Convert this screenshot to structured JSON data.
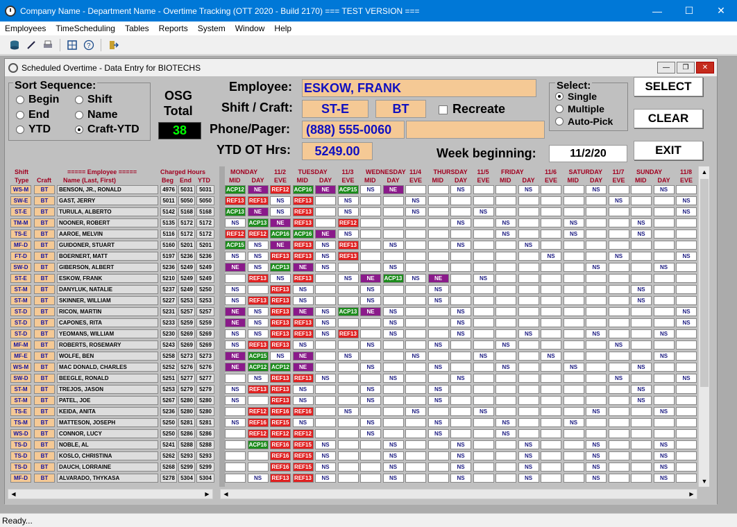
{
  "window": {
    "title": "Company Name - Department Name - Overtime Tracking (OTT 2020 - Build 2170)  === TEST VERSION ==="
  },
  "menu": [
    "Employees",
    "TimeScheduling",
    "Tables",
    "Reports",
    "System",
    "Window",
    "Help"
  ],
  "child": {
    "title": "Scheduled Overtime - Data Entry for BIOTECHS"
  },
  "sort": {
    "legend": "Sort Sequence:",
    "options": [
      {
        "label": "Begin",
        "selected": false
      },
      {
        "label": "End",
        "selected": false
      },
      {
        "label": "YTD",
        "selected": false
      },
      {
        "label": "Shift",
        "selected": false
      },
      {
        "label": "Name",
        "selected": false
      },
      {
        "label": "Craft-YTD",
        "selected": true
      }
    ]
  },
  "osg": {
    "label1": "OSG",
    "label2": "Total",
    "value": "38"
  },
  "employee": {
    "label": "Employee:",
    "value": "ESKOW, FRANK",
    "shift_label": "Shift / Craft:",
    "shift": "ST-E",
    "craft": "BT",
    "recreate_label": "Recreate",
    "phone_label": "Phone/Pager:",
    "phone": "(888) 555-0060",
    "ytd_label": "YTD OT Hrs:",
    "ytd": "5249.00",
    "week_label": "Week beginning:",
    "week": "11/2/20"
  },
  "select": {
    "legend": "Select:",
    "options": [
      {
        "label": "Single",
        "selected": true
      },
      {
        "label": "Multiple",
        "selected": false
      },
      {
        "label": "Auto-Pick",
        "selected": false
      }
    ]
  },
  "buttons": {
    "select": "SELECT",
    "clear": "CLEAR",
    "exit": "EXIT"
  },
  "grid": {
    "left_headers": {
      "shift": "Shift",
      "type": "Type",
      "craft": "Craft",
      "employee": "===== Employee =====",
      "name": "Name (Last, First)",
      "charged": "Charged Hours",
      "beg": "Beg",
      "end": "End",
      "ytd": "YTD"
    },
    "days": [
      {
        "name": "MONDAY",
        "date": "11/2"
      },
      {
        "name": "TUESDAY",
        "date": "11/3"
      },
      {
        "name": "WEDNESDAY",
        "date": "11/4"
      },
      {
        "name": "THURSDAY",
        "date": "11/5"
      },
      {
        "name": "FRIDAY",
        "date": "11/6"
      },
      {
        "name": "SATURDAY",
        "date": "11/7"
      },
      {
        "name": "SUNDAY",
        "date": "11/8"
      }
    ],
    "shift_cols": [
      "MID",
      "DAY",
      "EVE"
    ],
    "rows": [
      [
        "WS-M",
        "BT",
        "BENSON, JR., RONALD",
        "4976",
        "5031",
        "5031",
        "ACP12|NE|REF12|ACP16|NE|ACP15|NS|NE|||NS|||NS|||NS|||NS"
      ],
      [
        "SW-E",
        "BT",
        "GAST, JERRY",
        "5011",
        "5050",
        "5050",
        "REF13|REF13|NS|REF13||NS|||NS|||||||||NS|||NS"
      ],
      [
        "ST-E",
        "BT",
        "TURULA, ALBERTO",
        "5142",
        "5168",
        "5168",
        "ACP13|NE|NS|REF13||NS|||NS|||NS|||||||||NS"
      ],
      [
        "TM-M",
        "BT",
        "NOONER, ROBERT",
        "5135",
        "5172",
        "5172",
        "NS|ACP13|NE|REF13||REF12|||||NS||NS|||NS|||NS"
      ],
      [
        "TS-E",
        "BT",
        "AAROE, MELVIN",
        "5116",
        "5172",
        "5172",
        "REF12|REF12|ACP16|ACP16|NE|NS|||||||NS|||NS|||NS"
      ],
      [
        "MF-D",
        "BT",
        "GUIDONER, STUART",
        "5160",
        "5201",
        "5201",
        "ACP15|NS|NE|REF13|NS|REF13||NS|||NS|||NS"
      ],
      [
        "FT-D",
        "BT",
        "BOERNERT, MATT",
        "5197",
        "5236",
        "5236",
        "NS|NS|REF13|REF13|NS|REF13|||||||||NS|||NS|||NS"
      ],
      [
        "SW-D",
        "BT",
        "GIBERSON, ALBERT",
        "5236",
        "5249",
        "5249",
        "NE|NS|ACP13|NE|NS|||NS|||||||||NS|||NS"
      ],
      [
        "ST-E",
        "BT",
        "ESKOW, FRANK",
        "5210",
        "5249",
        "5249",
        "|REF13|NS|REF13||NS|NE|ACP13|NS|NE||NS|||||||||||NS"
      ],
      [
        "ST-M",
        "BT",
        "DANYLUK, NATALIE",
        "5237",
        "5249",
        "5250",
        "NS||REF13|NS|||NS|||NS|||||||||NS"
      ],
      [
        "ST-M",
        "BT",
        "SKINNER, WILLIAM",
        "5227",
        "5253",
        "5253",
        "NS|REF13|REF13|NS|||NS|||NS|||||||||NS"
      ],
      [
        "ST-D",
        "BT",
        "RICON, MARTIN",
        "5231",
        "5257",
        "5257",
        "NE|NS|REF13|NE|NS|ACP13|NE|NS|||NS||||||||||NS"
      ],
      [
        "ST-D",
        "BT",
        "CAPONES, RITA",
        "5233",
        "5259",
        "5259",
        "NE|NS|REF13|REF13|NS|||NS|||NS||||||||||NS"
      ],
      [
        "ST-D",
        "BT",
        "YEOMANS, WILLIAM",
        "5230",
        "5269",
        "5269",
        "NS|NS|REF13|REF13|NS|REF13||NS|||NS|||NS|||NS|||NS"
      ],
      [
        "MF-M",
        "BT",
        "ROBERTS, ROSEMARY",
        "5243",
        "5269",
        "5269",
        "NS|REF13|REF13|NS|||NS|||NS|||NS|||||NS"
      ],
      [
        "MF-E",
        "BT",
        "WOLFE, BEN",
        "5258",
        "5273",
        "5273",
        "NE|ACP15|NS|NE||NS|||NS|||NS|||NS|||||NS"
      ],
      [
        "WS-M",
        "BT",
        "MAC DONALD, CHARLES",
        "5252",
        "5276",
        "5276",
        "NE|ACP12|ACP12|NE|||NS|||NS|||NS|||NS|||NS"
      ],
      [
        "SW-D",
        "BT",
        "BEEGLE, RONALD",
        "5251",
        "5277",
        "5277",
        "|NS|REF13|REF13|NS|||NS|||NS|||||||NS|||NS"
      ],
      [
        "ST-M",
        "BT",
        "TREJOS, JASON",
        "5253",
        "5279",
        "5279",
        "NS|REF13|REF13|NS|||NS|||NS|||||||||NS"
      ],
      [
        "ST-M",
        "BT",
        "PATEL, JOE",
        "5267",
        "5280",
        "5280",
        "NS||REF13|NS|||NS|||NS|||||||||NS"
      ],
      [
        "TS-E",
        "BT",
        "KEIDA, ANITA",
        "5236",
        "5280",
        "5280",
        "|REF12|REF16|REF16||NS|||NS|||NS|||||NS|||NS"
      ],
      [
        "TS-M",
        "BT",
        "MATTESON, JOSEPH",
        "5250",
        "5281",
        "5281",
        "NS|REF16|REF15|NS|||NS|||NS|||NS|||NS"
      ],
      [
        "WS-D",
        "BT",
        "CONNOR, LUCY",
        "5250",
        "5286",
        "5286",
        "|REF12|REF12|REF12|||NS|||NS|||NS|||||||||NS"
      ],
      [
        "TS-D",
        "BT",
        "NOBLE, AL",
        "5241",
        "5288",
        "5288",
        "|ACP16|REF16|REF15|NS|||NS|||NS|||NS|||NS|||NS"
      ],
      [
        "TS-D",
        "BT",
        "KOSLO, CHRISTINA",
        "5262",
        "5293",
        "5293",
        "||REF16|REF15|NS|||NS|||NS|||NS|||NS|||NS"
      ],
      [
        "TS-D",
        "BT",
        "DAUCH, LORRAINE",
        "5268",
        "5299",
        "5299",
        "||REF16|REF15|NS|||NS|||NS|||NS|||NS|||NS"
      ],
      [
        "MF-D",
        "BT",
        "ALVARADO, THYKASA",
        "5278",
        "5304",
        "5304",
        "|NS|REF13|REF13|NS|||NS|||NS|||NS|||NS|||NS"
      ]
    ]
  },
  "status": "Ready..."
}
